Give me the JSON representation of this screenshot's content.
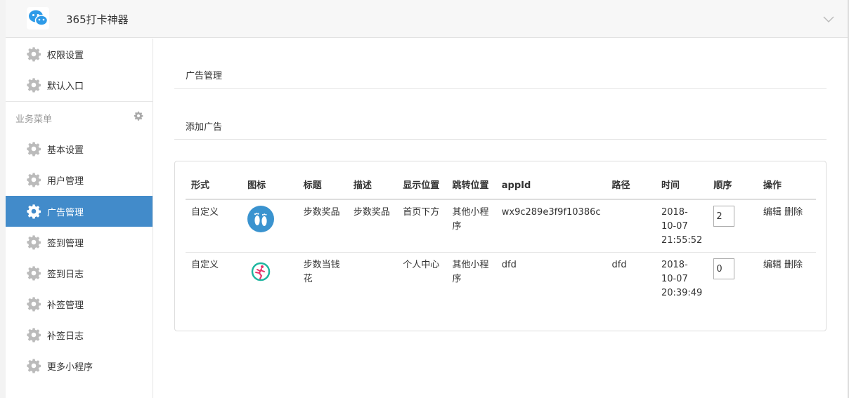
{
  "app": {
    "title": "365打卡神器"
  },
  "sidebar": {
    "top_items": [
      {
        "label": "权限设置"
      },
      {
        "label": "默认入口"
      }
    ],
    "section_title": "业务菜单",
    "items": [
      {
        "label": "基本设置"
      },
      {
        "label": "用户管理"
      },
      {
        "label": "广告管理"
      },
      {
        "label": "签到管理"
      },
      {
        "label": "签到日志"
      },
      {
        "label": "补签管理"
      },
      {
        "label": "补签日志"
      },
      {
        "label": "更多小程序"
      }
    ],
    "active_item": "广告管理"
  },
  "main": {
    "breadcrumb": "广告管理",
    "add_link": "添加广告",
    "table": {
      "headers": [
        "形式",
        "图标",
        "标题",
        "描述",
        "显示位置",
        "跳转位置",
        "appId",
        "路径",
        "时间",
        "顺序",
        "操作"
      ],
      "rows": [
        {
          "form": "自定义",
          "icon": "footprints-icon",
          "title": "步数奖品",
          "desc": "步数奖品",
          "position": "首页下方",
          "jump": "其他小程序",
          "appid": "wx9c289e3f9f10386c",
          "path": "",
          "time": "2018-10-07 21:55:52",
          "order": "2",
          "edit": "编辑",
          "delete": "删除"
        },
        {
          "form": "自定义",
          "icon": "runner-icon",
          "title": "步数当钱花",
          "desc": "",
          "position": "个人中心",
          "jump": "其他小程序",
          "appid": "dfd",
          "path": "dfd",
          "time": "2018-10-07 20:39:49",
          "order": "0",
          "edit": "编辑",
          "delete": "删除"
        }
      ]
    }
  },
  "colors": {
    "active_bg": "#428bca",
    "gear": "#bbbbbb",
    "logo_blue": "#2e9be8"
  }
}
